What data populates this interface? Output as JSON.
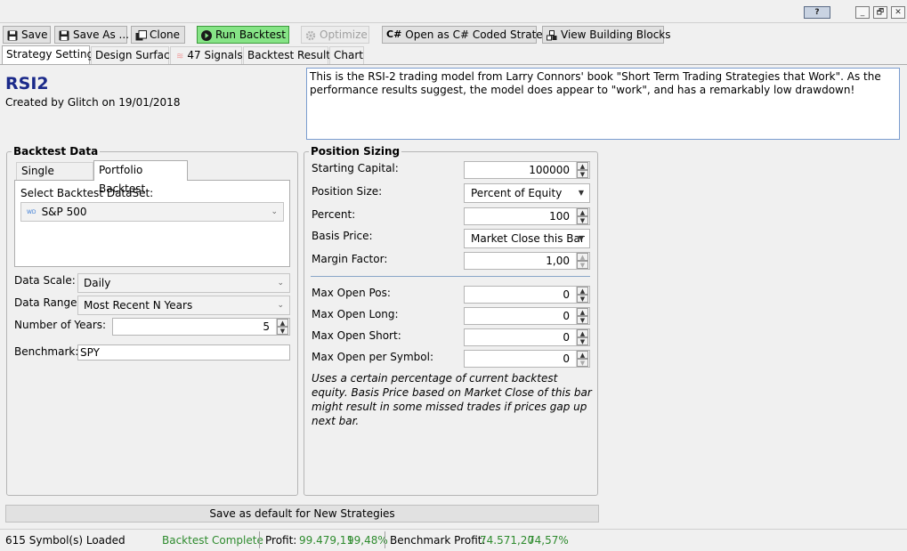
{
  "window": {
    "help_label": "?",
    "minimize": "_",
    "restore": "🗗",
    "close": "✕"
  },
  "toolbar": {
    "save": "Save",
    "save_as": "Save As ...",
    "clone": "Clone",
    "run_backtest": "Run Backtest",
    "optimize": "Optimize",
    "open_csharp": "Open as C# Coded Strategy",
    "csharp_badge": "C#",
    "view_blocks": "View Building Blocks"
  },
  "tabs": {
    "strategy_settings": "Strategy Settings",
    "design_surface": "Design Surface",
    "signals": "47 Signals",
    "backtest_results": "Backtest Results",
    "chart": "Chart"
  },
  "strategy": {
    "name": "RSI2",
    "created": "Created by Glitch on 19/01/2018",
    "description": "This is the RSI-2 trading model from Larry Connors' book \"Short Term Trading Strategies that Work\". As the performance results suggest, the model does appear to \"work\", and has a remarkably low drawdown!"
  },
  "backtest_data": {
    "legend": "Backtest Data",
    "tab_single": "Single Symbol",
    "tab_portfolio": "Portfolio Backtest",
    "select_label": "Select Backtest DataSet:",
    "dataset_badge": "WD",
    "dataset": "S&P 500",
    "data_scale_label": "Data Scale:",
    "data_scale": "Daily",
    "data_range_label": "Data Range:",
    "data_range": "Most Recent N Years",
    "num_years_label": "Number of Years:",
    "num_years": "5",
    "benchmark_label": "Benchmark:",
    "benchmark": "SPY"
  },
  "position_sizing": {
    "legend": "Position Sizing",
    "starting_capital_label": "Starting Capital:",
    "starting_capital": "100000",
    "position_size_label": "Position Size:",
    "position_size": "Percent of Equity",
    "percent_label": "Percent:",
    "percent": "100",
    "basis_price_label": "Basis Price:",
    "basis_price": "Market Close this Bar",
    "margin_factor_label": "Margin Factor:",
    "margin_factor": "1,00",
    "max_open_pos_label": "Max Open Pos:",
    "max_open_pos": "0",
    "max_open_long_label": "Max Open Long:",
    "max_open_long": "0",
    "max_open_short_label": "Max Open Short:",
    "max_open_short": "0",
    "max_open_symbol_label": "Max Open per Symbol:",
    "max_open_symbol": "0",
    "note": "Uses a certain percentage of current backtest equity. Basis Price based on Market Close of this bar might result in some missed trades if prices gap up next bar."
  },
  "save_default": "Save as default for New Strategies",
  "status": {
    "symbols_loaded": "615 Symbol(s) Loaded",
    "backtest_state": "Backtest Complete",
    "profit_label": "Profit:",
    "profit_value": "99.479,11",
    "profit_pct": "99,48%",
    "bench_label": "Benchmark Profit:",
    "bench_value": "74.571,20",
    "bench_pct": "74,57%"
  },
  "colors": {
    "accent_green": "#2e8b2e",
    "title_blue": "#1b2a8a",
    "run_bg": "#86e486"
  }
}
